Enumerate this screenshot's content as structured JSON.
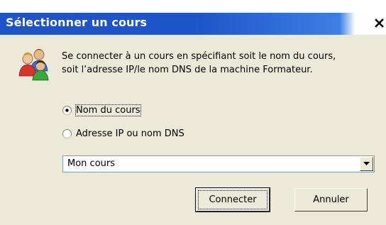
{
  "window": {
    "title": "Sélectionner un cours"
  },
  "description": {
    "line1": "Se connecter à un cours en spécifiant soit le nom du cours,",
    "line2": "soit l’adresse IP/le nom DNS de la machine Formateur."
  },
  "options": [
    {
      "label": "Nom du cours",
      "selected": true
    },
    {
      "label": "Adresse IP ou nom DNS",
      "selected": false
    }
  ],
  "combo": {
    "value": "Mon cours"
  },
  "buttons": {
    "connect": "Connecter",
    "cancel": "Annuler"
  },
  "colors": {
    "titlebar": "#1f53c8",
    "dialog_bg": "#ece9d8"
  },
  "icons": {
    "header": "users-icon",
    "close": "close-icon",
    "dropdown": "chevron-down-icon"
  }
}
